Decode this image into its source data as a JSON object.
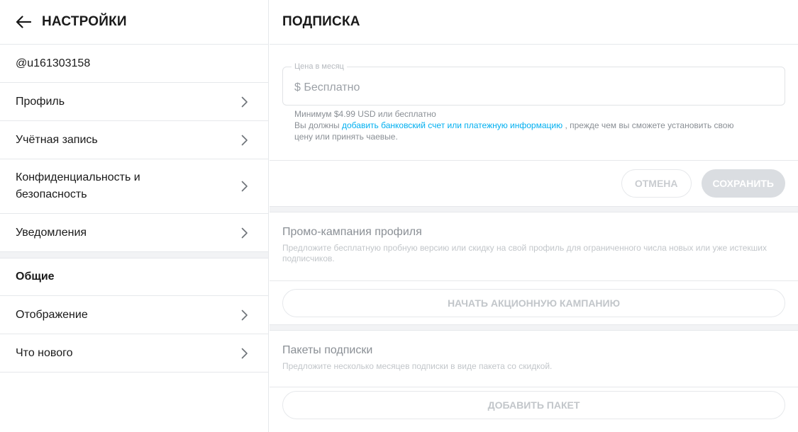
{
  "sidebar": {
    "title": "НАСТРОЙКИ",
    "back_icon": "arrow-left-icon",
    "username": "@u161303158",
    "items": [
      {
        "label": "Профиль",
        "icon": "chevron-right-icon"
      },
      {
        "label": "Учётная запись",
        "icon": "chevron-right-icon"
      },
      {
        "label": "Конфиденциальность и безопасность",
        "icon": "chevron-right-icon"
      },
      {
        "label": "Уведомления",
        "icon": "chevron-right-icon"
      }
    ],
    "general": {
      "title": "Общие",
      "items": [
        {
          "label": "Отображение",
          "icon": "chevron-right-icon"
        },
        {
          "label": "Что нового",
          "icon": "chevron-right-icon"
        }
      ]
    }
  },
  "main": {
    "title": "ПОДПИСКА",
    "price": {
      "legend": "Цена в месяц",
      "value": "$ Бесплатно"
    },
    "hint": {
      "line1": "Минимум $4.99 USD или бесплатно",
      "before_link": "Вы должны ",
      "link": "добавить банковский счет или платежную информацию",
      "after_link": " , прежде чем вы сможете установить свою цену или принять чаевые."
    },
    "actions": {
      "cancel": "ОТМЕНА",
      "save": "СОХРАНИТЬ"
    },
    "promo": {
      "title": "Промо-кампания профиля",
      "description": "Предложите бесплатную пробную версию или скидку на свой профиль для ограниченного числа новых или уже истекших подписчиков.",
      "button": "НАЧАТЬ АКЦИОННУЮ КАМПАНИЮ"
    },
    "bundles": {
      "title": "Пакеты подписки",
      "description": "Предложите несколько месяцев подписки в виде пакета со скидкой.",
      "button": "ДОБАВИТЬ ПАКЕТ"
    }
  },
  "colors": {
    "link": "#00aff0",
    "divider": "#e6e8eb",
    "gap_bg": "#f2f3f5",
    "save_disabled_bg": "#dadde1"
  }
}
